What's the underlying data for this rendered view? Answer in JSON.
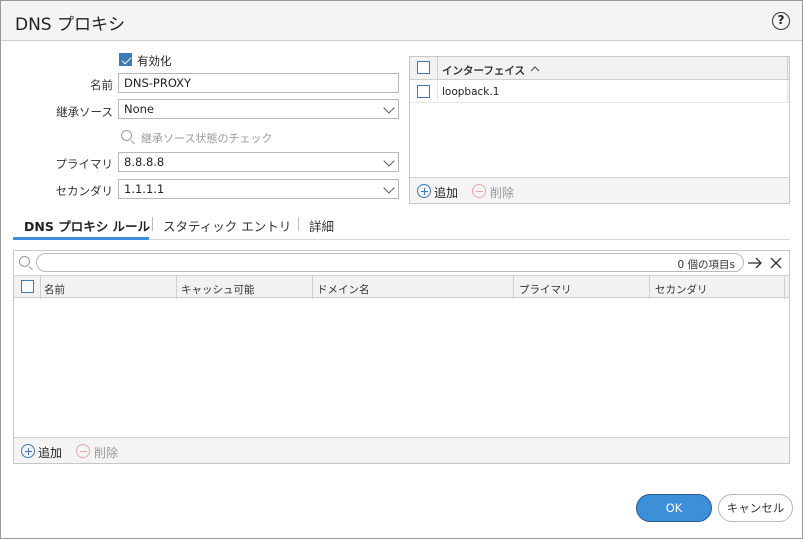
{
  "dialog": {
    "title": "DNS プロキシ"
  },
  "form": {
    "enabled_label": "有効化",
    "enabled": true,
    "name_label": "名前",
    "name_value": "DNS-PROXY",
    "inherit_label": "継承ソース",
    "inherit_value": "None",
    "inherit_check_label": "継承ソース状態のチェック",
    "primary_label": "プライマリ",
    "primary_value": "8.8.8.8",
    "secondary_label": "セカンダリ",
    "secondary_value": "1.1.1.1"
  },
  "interfaces": {
    "header": "インターフェイス",
    "rows": [
      "loopback.1"
    ],
    "add_label": "追加",
    "delete_label": "削除"
  },
  "tabs": [
    {
      "label": "DNS プロキシ ルール",
      "active": true
    },
    {
      "label": "スタティック エントリ",
      "active": false
    },
    {
      "label": "詳細",
      "active": false
    }
  ],
  "rules": {
    "count_text": "0 個の項目s",
    "columns": [
      "名前",
      "キャッシュ可能",
      "ドメイン名",
      "プライマリ",
      "セカンダリ"
    ],
    "add_label": "追加",
    "delete_label": "削除"
  },
  "buttons": {
    "ok": "OK",
    "cancel": "キャンセル"
  },
  "colors": {
    "accent": "#3c8fd8",
    "checkbox": "#3d79b5",
    "delete_disabled": "#e6a9a9"
  }
}
